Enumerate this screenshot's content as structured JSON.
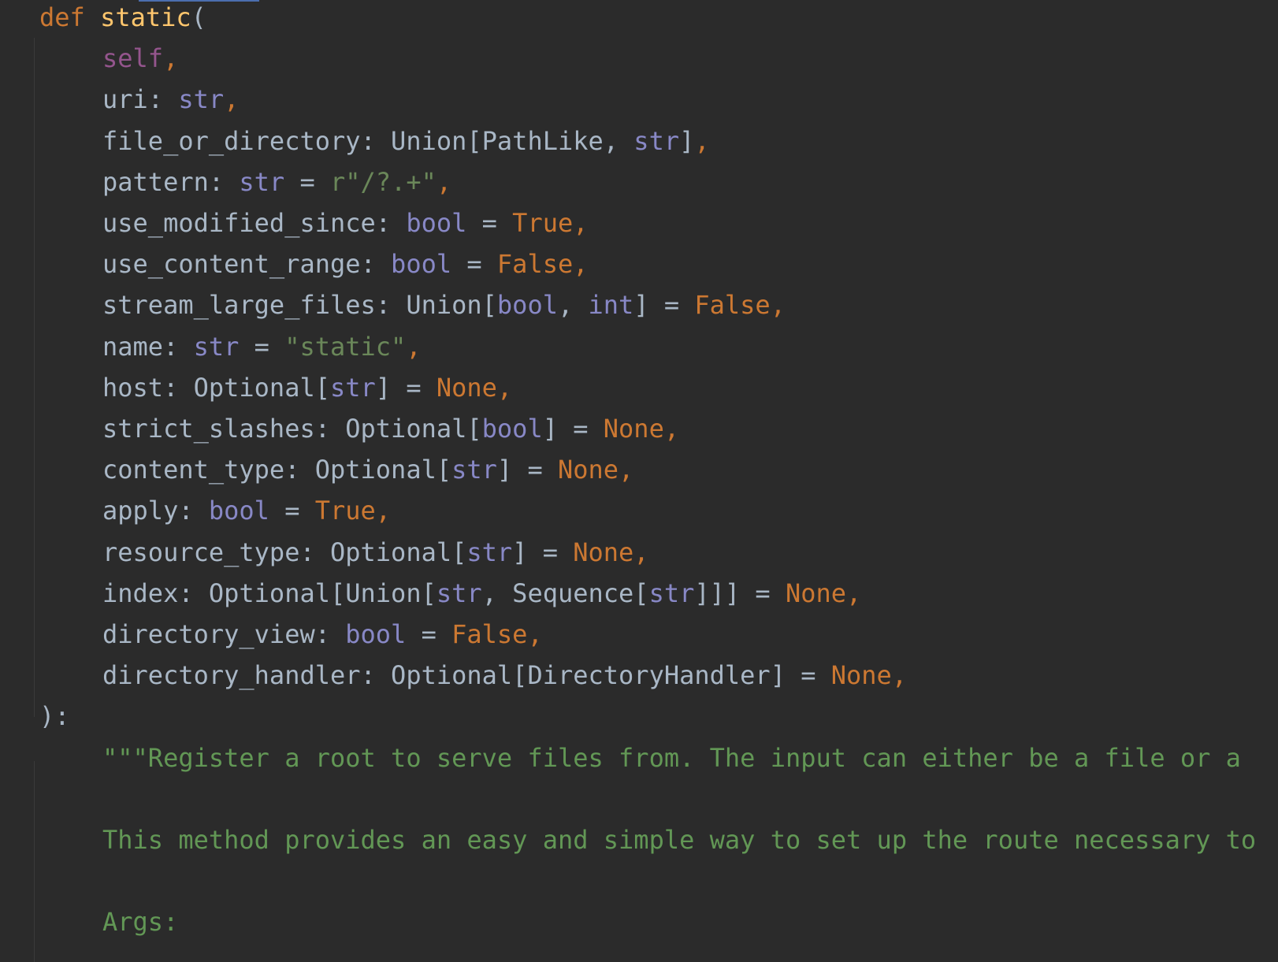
{
  "editor": {
    "lines": [
      [
        {
          "t": "def",
          "c": "kw"
        },
        {
          "t": " ",
          "c": "plain"
        },
        {
          "t": "static",
          "c": "fn"
        },
        {
          "t": "(",
          "c": "plain"
        }
      ],
      [
        {
          "t": "self",
          "c": "self"
        },
        {
          "t": ",",
          "c": "kw"
        }
      ],
      [
        {
          "t": "uri: ",
          "c": "plain"
        },
        {
          "t": "str",
          "c": "builtin"
        },
        {
          "t": ",",
          "c": "kw"
        }
      ],
      [
        {
          "t": "file_or_directory: Union[PathLike, ",
          "c": "plain"
        },
        {
          "t": "str",
          "c": "builtin"
        },
        {
          "t": "]",
          "c": "plain"
        },
        {
          "t": ",",
          "c": "kw"
        }
      ],
      [
        {
          "t": "pattern: ",
          "c": "plain"
        },
        {
          "t": "str",
          "c": "builtin"
        },
        {
          "t": " = ",
          "c": "plain"
        },
        {
          "t": "r\"/?.+\"",
          "c": "str"
        },
        {
          "t": ",",
          "c": "kw"
        }
      ],
      [
        {
          "t": "use_modified_since: ",
          "c": "plain"
        },
        {
          "t": "bool",
          "c": "builtin"
        },
        {
          "t": " = ",
          "c": "plain"
        },
        {
          "t": "True",
          "c": "const"
        },
        {
          "t": ",",
          "c": "kw"
        }
      ],
      [
        {
          "t": "use_content_range: ",
          "c": "plain"
        },
        {
          "t": "bool",
          "c": "builtin"
        },
        {
          "t": " = ",
          "c": "plain"
        },
        {
          "t": "False",
          "c": "const"
        },
        {
          "t": ",",
          "c": "kw"
        }
      ],
      [
        {
          "t": "stream_large_files: Union[",
          "c": "plain"
        },
        {
          "t": "bool",
          "c": "builtin"
        },
        {
          "t": ", ",
          "c": "plain"
        },
        {
          "t": "int",
          "c": "builtin"
        },
        {
          "t": "] = ",
          "c": "plain"
        },
        {
          "t": "False",
          "c": "const"
        },
        {
          "t": ",",
          "c": "kw"
        }
      ],
      [
        {
          "t": "name: ",
          "c": "plain"
        },
        {
          "t": "str",
          "c": "builtin"
        },
        {
          "t": " = ",
          "c": "plain"
        },
        {
          "t": "\"static\"",
          "c": "str"
        },
        {
          "t": ",",
          "c": "kw"
        }
      ],
      [
        {
          "t": "host: Optional[",
          "c": "plain"
        },
        {
          "t": "str",
          "c": "builtin"
        },
        {
          "t": "] = ",
          "c": "plain"
        },
        {
          "t": "None",
          "c": "const"
        },
        {
          "t": ",",
          "c": "kw"
        }
      ],
      [
        {
          "t": "strict_slashes: Optional[",
          "c": "plain"
        },
        {
          "t": "bool",
          "c": "builtin"
        },
        {
          "t": "] = ",
          "c": "plain"
        },
        {
          "t": "None",
          "c": "const"
        },
        {
          "t": ",",
          "c": "kw"
        }
      ],
      [
        {
          "t": "content_type: Optional[",
          "c": "plain"
        },
        {
          "t": "str",
          "c": "builtin"
        },
        {
          "t": "] = ",
          "c": "plain"
        },
        {
          "t": "None",
          "c": "const"
        },
        {
          "t": ",",
          "c": "kw"
        }
      ],
      [
        {
          "t": "apply: ",
          "c": "plain"
        },
        {
          "t": "bool",
          "c": "builtin"
        },
        {
          "t": " = ",
          "c": "plain"
        },
        {
          "t": "True",
          "c": "const"
        },
        {
          "t": ",",
          "c": "kw"
        }
      ],
      [
        {
          "t": "resource_type: Optional[",
          "c": "plain"
        },
        {
          "t": "str",
          "c": "builtin"
        },
        {
          "t": "] = ",
          "c": "plain"
        },
        {
          "t": "None",
          "c": "const"
        },
        {
          "t": ",",
          "c": "kw"
        }
      ],
      [
        {
          "t": "index: Optional[Union[",
          "c": "plain"
        },
        {
          "t": "str",
          "c": "builtin"
        },
        {
          "t": ", Sequence[",
          "c": "plain"
        },
        {
          "t": "str",
          "c": "builtin"
        },
        {
          "t": "]]] = ",
          "c": "plain"
        },
        {
          "t": "None",
          "c": "const"
        },
        {
          "t": ",",
          "c": "kw"
        }
      ],
      [
        {
          "t": "directory_view: ",
          "c": "plain"
        },
        {
          "t": "bool",
          "c": "builtin"
        },
        {
          "t": " = ",
          "c": "plain"
        },
        {
          "t": "False",
          "c": "const"
        },
        {
          "t": ",",
          "c": "kw"
        }
      ],
      [
        {
          "t": "directory_handler: Optional[DirectoryHandler] = ",
          "c": "plain"
        },
        {
          "t": "None",
          "c": "const"
        },
        {
          "t": ",",
          "c": "kw"
        }
      ],
      [
        {
          "t": "):",
          "c": "plain"
        }
      ],
      [
        {
          "t": "\"\"\"Register a root to serve files from. The input can either be a file or a",
          "c": "doc"
        }
      ],
      [
        {
          "t": "",
          "c": "plain"
        }
      ],
      [
        {
          "t": "This method provides an easy and simple way to set up the route necessary to",
          "c": "doc"
        }
      ],
      [
        {
          "t": "",
          "c": "plain"
        }
      ],
      [
        {
          "t": "Args:",
          "c": "doc"
        }
      ]
    ],
    "indent": [
      0,
      1,
      1,
      1,
      1,
      1,
      1,
      1,
      1,
      1,
      1,
      1,
      1,
      1,
      1,
      1,
      1,
      0,
      1,
      1,
      1,
      1,
      1
    ],
    "colors": {
      "background": "#2b2b2b",
      "keyword": "#cc7832",
      "function": "#ffc66d",
      "self": "#94558d",
      "builtin": "#8888c6",
      "string": "#6a8759",
      "docstring": "#629755",
      "plain": "#a9b7c6"
    }
  }
}
